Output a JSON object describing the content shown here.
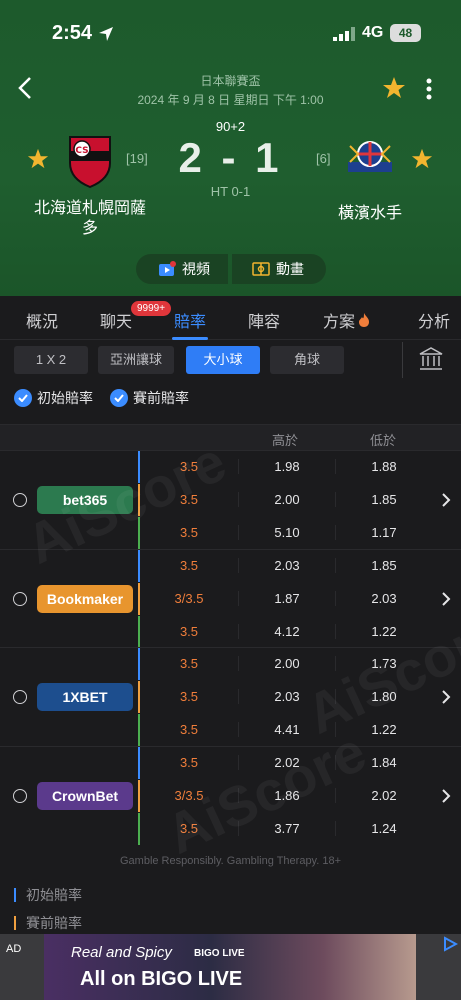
{
  "status_bar": {
    "time": "2:54",
    "network": "4G",
    "battery": "48"
  },
  "match": {
    "league": "日本聯賽盃",
    "date": "2024 年 9 月 8 日 星期日 下午 1:00",
    "minute": "90+2",
    "score": "2 - 1",
    "halftime": "HT 0-1",
    "home": {
      "name_line1": "北海道札幌岡薩",
      "name_line2": "多",
      "rank": "[19]"
    },
    "away": {
      "name": "橫濱水手",
      "rank": "[6]"
    }
  },
  "media": {
    "video": "視頻",
    "animation": "動畫"
  },
  "tabs": [
    "概況",
    "聊天",
    "賠率",
    "陣容",
    "方案",
    "分析"
  ],
  "chat_badge": "9999+",
  "subtabs": [
    "1 X 2",
    "亞洲讓球",
    "大小球",
    "角球"
  ],
  "filters": {
    "initial": "初始賠率",
    "pre": "賽前賠率"
  },
  "columns": {
    "high": "高於",
    "low": "低於"
  },
  "bookmakers": [
    {
      "name": "bet365",
      "color": "#2c7a4f",
      "rows": [
        {
          "line": "3.5",
          "high": "1.98",
          "low": "1.88"
        },
        {
          "line": "3.5",
          "high": "2.00",
          "low": "1.85"
        },
        {
          "line": "3.5",
          "high": "5.10",
          "low": "1.17"
        }
      ]
    },
    {
      "name": "Bookmaker",
      "color": "#e8952e",
      "rows": [
        {
          "line": "3.5",
          "high": "2.03",
          "low": "1.85"
        },
        {
          "line": "3/3.5",
          "high": "1.87",
          "low": "2.03"
        },
        {
          "line": "3.5",
          "high": "4.12",
          "low": "1.22"
        }
      ]
    },
    {
      "name": "1XBET",
      "color": "#1d4e8e",
      "rows": [
        {
          "line": "3.5",
          "high": "2.00",
          "low": "1.73"
        },
        {
          "line": "3.5",
          "high": "2.03",
          "low": "1.80"
        },
        {
          "line": "3.5",
          "high": "4.41",
          "low": "1.22"
        }
      ]
    },
    {
      "name": "CrownBet",
      "color": "#5b3a8c",
      "rows": [
        {
          "line": "3.5",
          "high": "2.02",
          "low": "1.84"
        },
        {
          "line": "3/3.5",
          "high": "1.86",
          "low": "2.02"
        },
        {
          "line": "3.5",
          "high": "3.77",
          "low": "1.24"
        }
      ]
    }
  ],
  "row_colors": [
    "#3b8cff",
    "#f0a040",
    "#4caf50"
  ],
  "gamble_note": "Gamble Responsibly. Gambling Therapy. 18+",
  "legend": {
    "initial": "初始賠率",
    "pre": "賽前賠率"
  },
  "ad": {
    "label": "AD",
    "line1": "Real and Spicy",
    "brand_small": "BIGO LIVE",
    "line2": "All on BIGO LIVE"
  },
  "watermark": "AiScore"
}
